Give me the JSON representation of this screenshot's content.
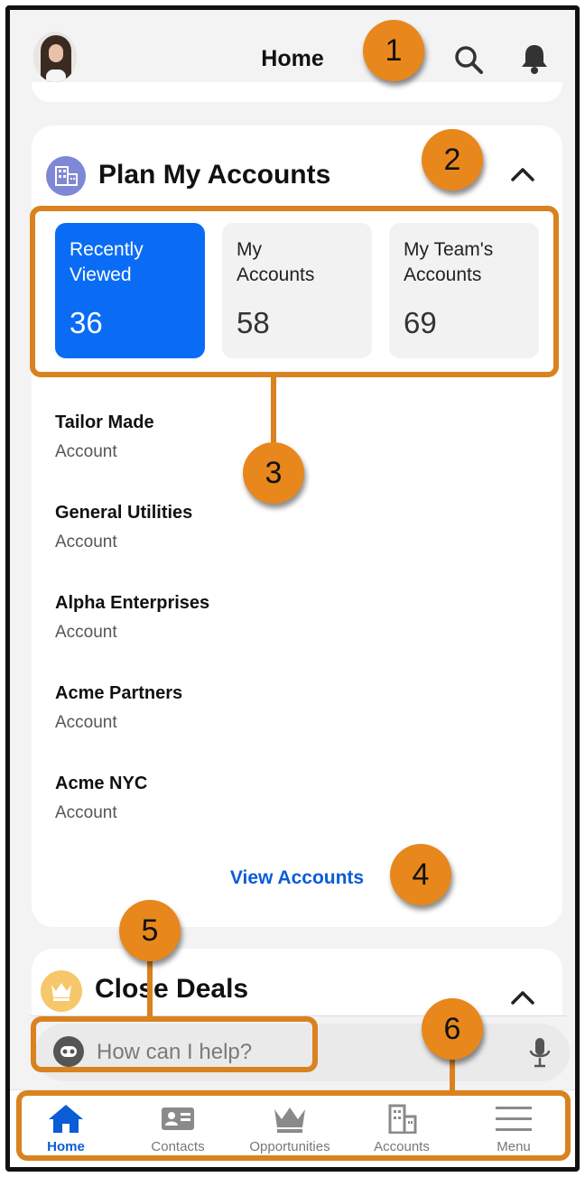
{
  "header": {
    "title": "Home",
    "avatar_icon": "user-avatar"
  },
  "plan_card": {
    "title": "Plan My Accounts",
    "tiles": [
      {
        "label": "Recently\nViewed",
        "count": "36",
        "active": true
      },
      {
        "label": "My\nAccounts",
        "count": "58",
        "active": false
      },
      {
        "label": "My Team's\nAccounts",
        "count": "69",
        "active": false
      }
    ],
    "records": [
      {
        "name": "Tailor Made",
        "type": "Account"
      },
      {
        "name": "General Utilities",
        "type": "Account"
      },
      {
        "name": "Alpha Enterprises",
        "type": "Account"
      },
      {
        "name": "Acme Partners",
        "type": "Account"
      },
      {
        "name": "Acme NYC",
        "type": "Account"
      }
    ],
    "view_link": "View Accounts"
  },
  "deals_card": {
    "title": "Close Deals"
  },
  "assistant": {
    "placeholder": "How can I help?"
  },
  "tabbar": {
    "items": [
      {
        "label": "Home",
        "icon": "home-icon",
        "active": true
      },
      {
        "label": "Contacts",
        "icon": "contact-card-icon",
        "active": false
      },
      {
        "label": "Opportunities",
        "icon": "crown-icon",
        "active": false
      },
      {
        "label": "Accounts",
        "icon": "building-icon",
        "active": false
      },
      {
        "label": "Menu",
        "icon": "hamburger-icon",
        "active": false
      }
    ]
  },
  "callouts": [
    "1",
    "2",
    "3",
    "4",
    "5",
    "6"
  ],
  "colors": {
    "accent": "#0a6cf5",
    "link": "#0b5cd5",
    "callout": "#e8871c"
  }
}
